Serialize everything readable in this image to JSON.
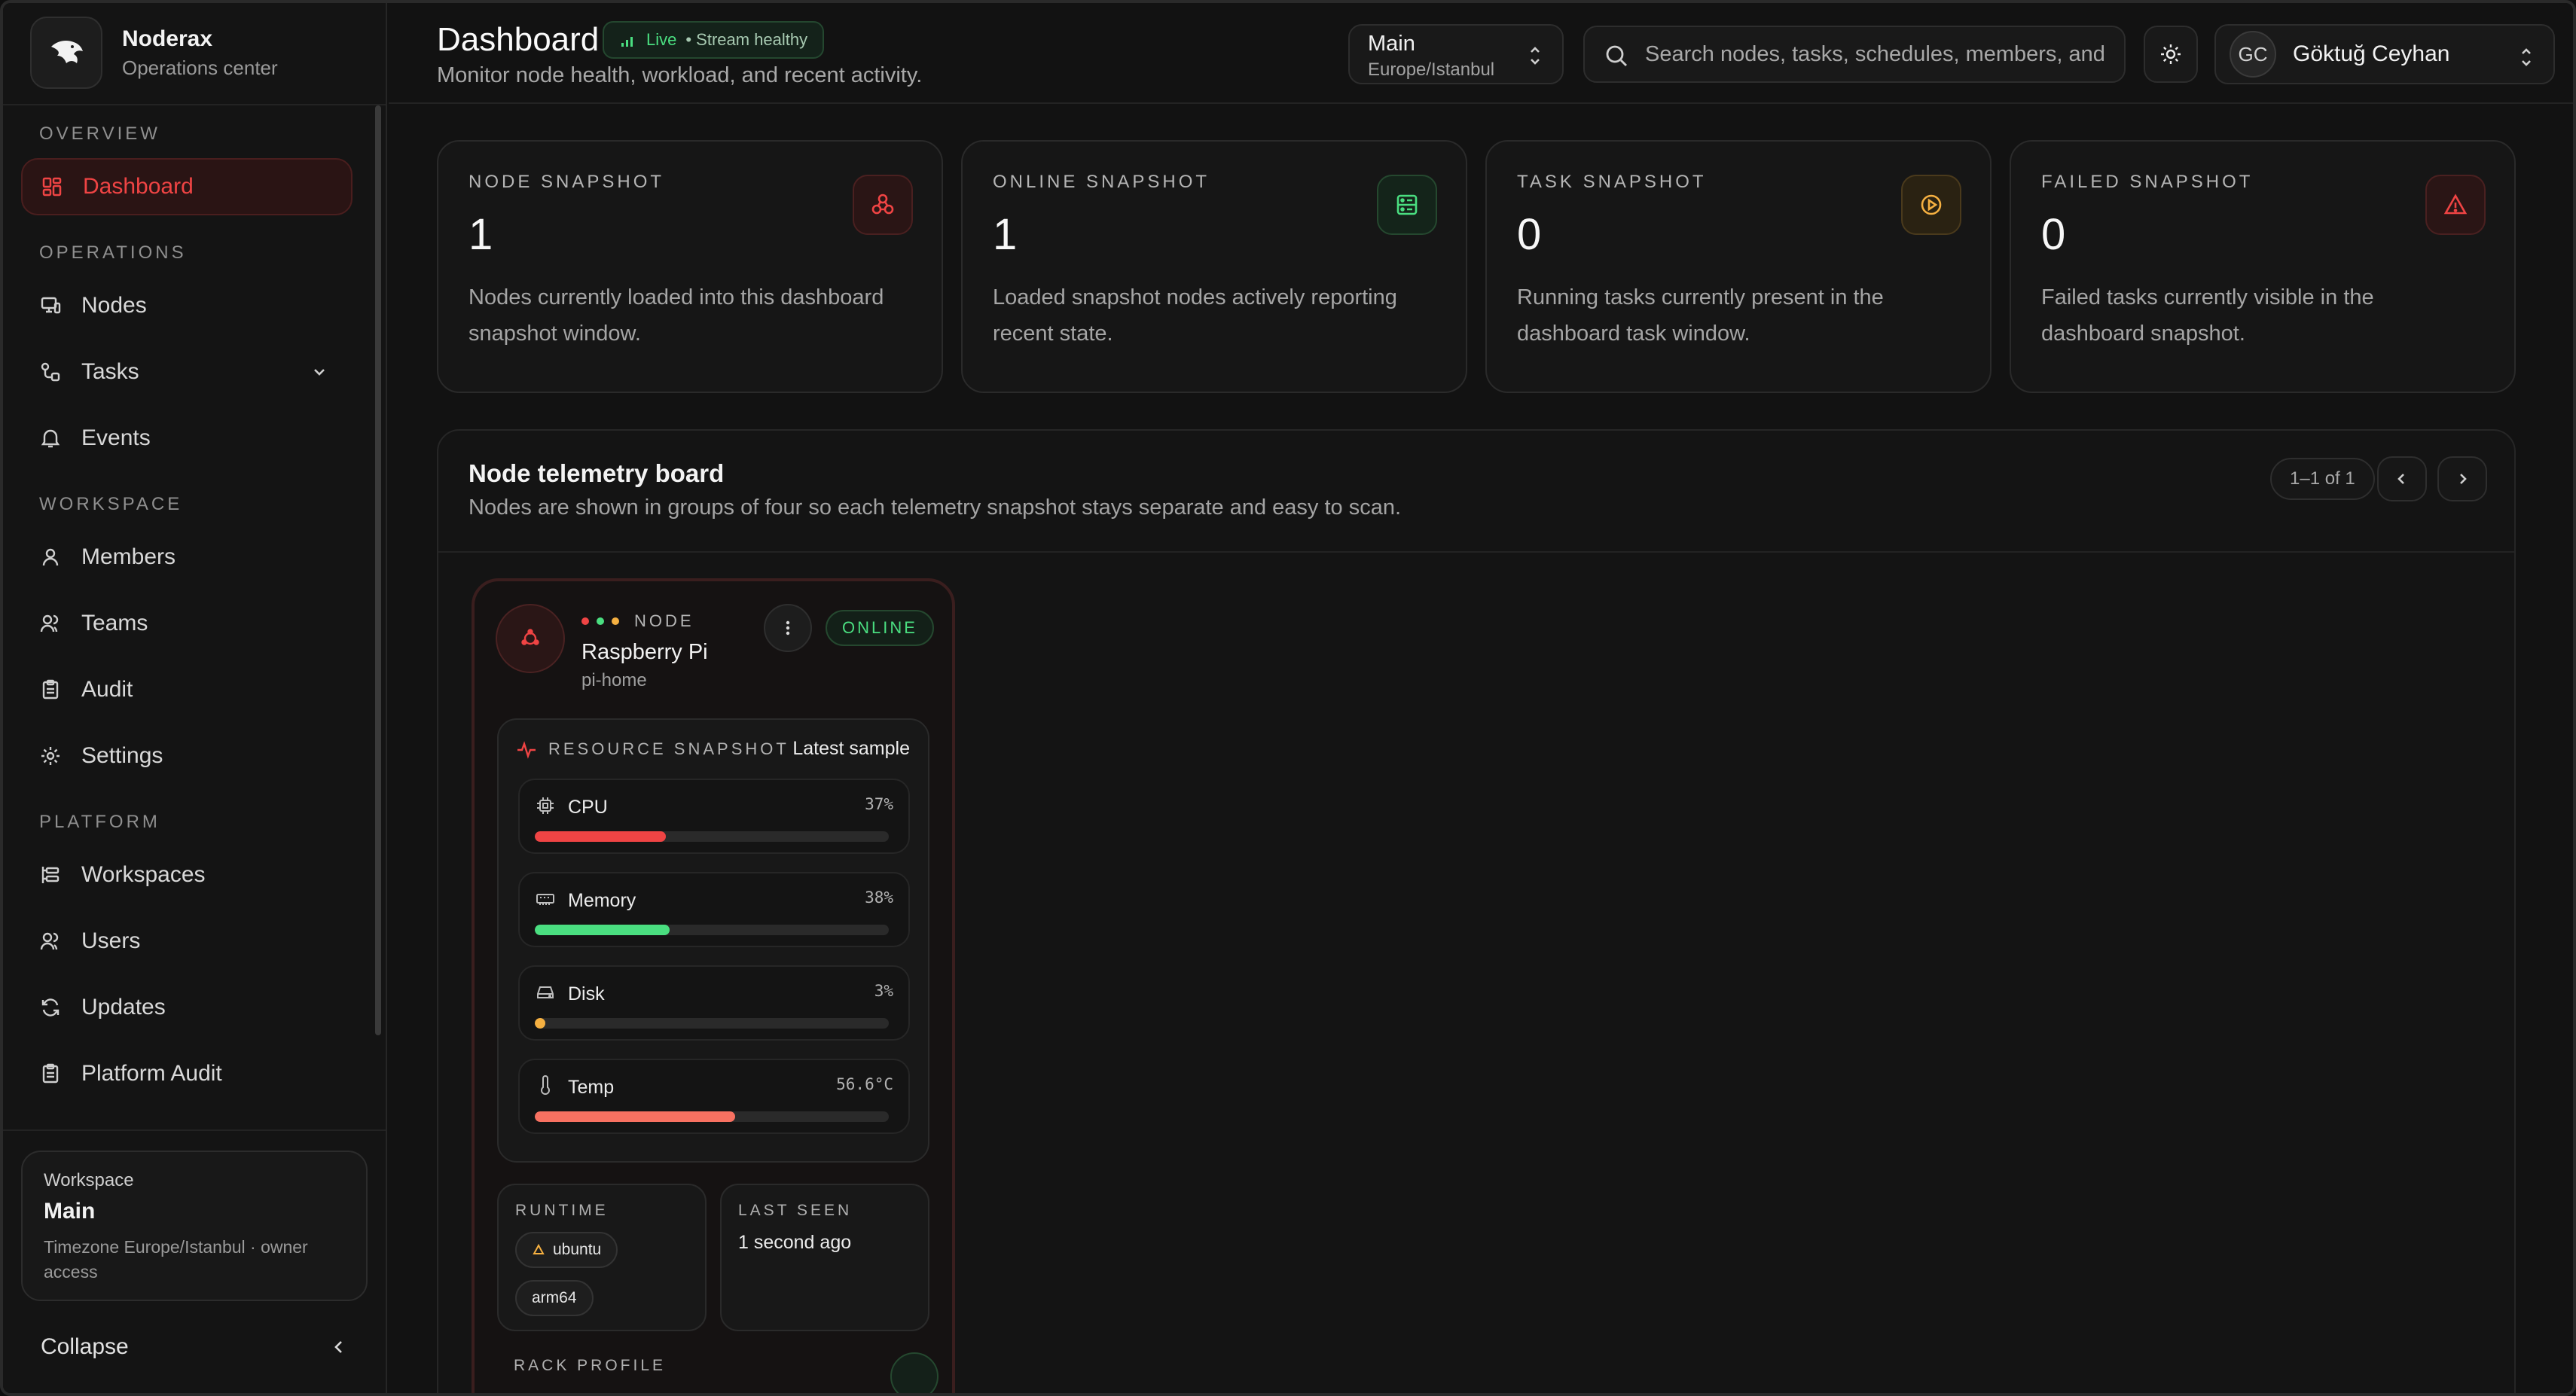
{
  "app": {
    "name": "Noderax",
    "subtitle": "Operations center"
  },
  "sidebar": {
    "sections": {
      "overview": "OVERVIEW",
      "operations": "OPERATIONS",
      "workspace": "WORKSPACE",
      "platform": "PLATFORM"
    },
    "items": {
      "dashboard": "Dashboard",
      "nodes": "Nodes",
      "tasks": "Tasks",
      "events": "Events",
      "members": "Members",
      "teams": "Teams",
      "audit": "Audit",
      "settings": "Settings",
      "workspaces": "Workspaces",
      "users": "Users",
      "updates": "Updates",
      "platform_audit": "Platform Audit"
    },
    "workspace_card": {
      "label": "Workspace",
      "name": "Main",
      "description": "Timezone Europe/Istanbul · owner access"
    },
    "collapse_label": "Collapse"
  },
  "header": {
    "title": "Dashboard",
    "live_label": "Live",
    "stream_label": "• Stream healthy",
    "subtitle": "Monitor node health, workload, and recent activity.",
    "workspace_select": {
      "name": "Main",
      "timezone": "Europe/Istanbul"
    },
    "search_placeholder": "Search nodes, tasks, schedules, members, and more",
    "user": {
      "initials": "GC",
      "name": "Göktuğ Ceyhan"
    }
  },
  "stats": [
    {
      "label": "NODE SNAPSHOT",
      "value": "1",
      "description": "Nodes currently loaded into this dashboard snapshot window.",
      "icon": "cluster-icon",
      "accent": "#ef4444"
    },
    {
      "label": "ONLINE SNAPSHOT",
      "value": "1",
      "description": "Loaded snapshot nodes actively reporting recent state.",
      "icon": "server-icon",
      "accent": "#4ade80"
    },
    {
      "label": "TASK SNAPSHOT",
      "value": "0",
      "description": "Running tasks currently present in the dashboard task window.",
      "icon": "play-circle-icon",
      "accent": "#f5b041"
    },
    {
      "label": "FAILED SNAPSHOT",
      "value": "0",
      "description": "Failed tasks currently visible in the dashboard snapshot.",
      "icon": "warning-icon",
      "accent": "#ef4444"
    }
  ],
  "board": {
    "title": "Node telemetry board",
    "subtitle": "Nodes are shown in groups of four so each telemetry snapshot stays separate and easy to scan.",
    "pager": "1–1 of 1"
  },
  "node": {
    "tag": "NODE",
    "name": "Raspberry Pi",
    "hostname": "pi-home",
    "status": "ONLINE",
    "resource_title": "RESOURCE SNAPSHOT",
    "resource_latest": "Latest sample",
    "metrics": [
      {
        "name": "CPU",
        "value": "37%",
        "fraction": 0.37,
        "color": "#ef4444"
      },
      {
        "name": "Memory",
        "value": "38%",
        "fraction": 0.38,
        "color": "#4ade80"
      },
      {
        "name": "Disk",
        "value": "3%",
        "fraction": 0.03,
        "color": "#f5b041"
      },
      {
        "name": "Temp",
        "value": "56.6°C",
        "fraction": 0.566,
        "color": "#f87161"
      }
    ],
    "runtime_label": "RUNTIME",
    "runtime_os": "ubuntu",
    "runtime_arch": "arm64",
    "last_seen_label": "LAST SEEN",
    "last_seen_value": "1 second ago",
    "rack_label": "RACK PROFILE"
  },
  "colors": {
    "accent": "#ef4444",
    "success": "#4ade80",
    "warning": "#f5b041"
  }
}
